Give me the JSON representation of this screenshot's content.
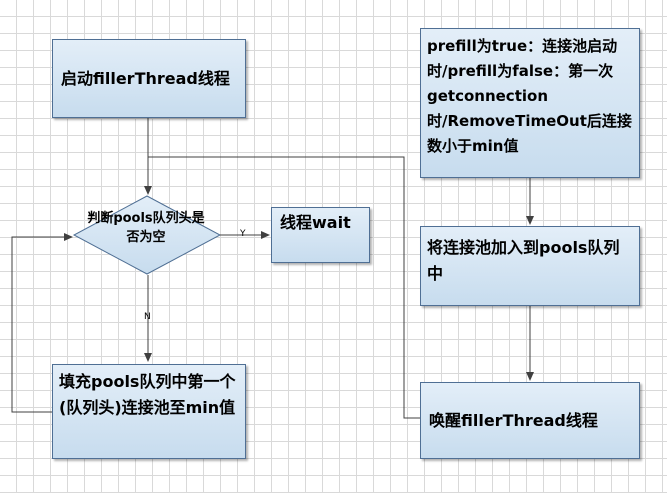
{
  "nodes": {
    "start_filler": "启动fillerThread线程",
    "check_empty": "判断pools队列头是否为空",
    "thread_wait": "线程wait",
    "fill_pool": "填充pools队列中第一个(队列头)连接池至min值",
    "prefill_cond": "prefill为true：连接池启动时/prefill为false：第一次getconnection时/RemoveTimeOut后连接数小于min值",
    "add_to_pool": "将连接池加入到pools队列中",
    "wake_filler": "唤醒fillerThread线程"
  },
  "edges": {
    "yes_label": "Y",
    "no_label": "N"
  },
  "colors": {
    "box_top": "#e3eef8",
    "box_bottom": "#c7dcee",
    "box_border": "#4f6f94",
    "line": "#404040"
  }
}
